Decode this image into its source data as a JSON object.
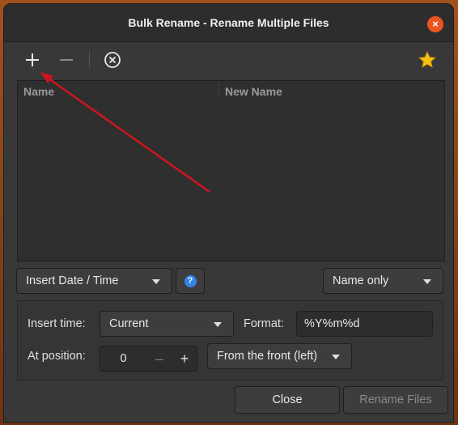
{
  "window": {
    "title": "Bulk Rename - Rename Multiple Files",
    "close_glyph": "×"
  },
  "toolbar": {
    "icons": [
      "plus-icon",
      "minus-icon",
      "clear-icon",
      "star-icon"
    ]
  },
  "file_list": {
    "columns": [
      "Name",
      "New Name"
    ],
    "rows": []
  },
  "renamer": {
    "type_selected": "Insert Date / Time",
    "help_glyph": "?",
    "scope_selected": "Name only"
  },
  "options": {
    "insert_time_label": "Insert time:",
    "insert_time_value": "Current",
    "format_label": "Format:",
    "format_value": "%Y%m%d",
    "position_label": "At position:",
    "position_value": "0",
    "position_minus": "–",
    "position_plus": "+",
    "position_from": "From the front (left)"
  },
  "actions": {
    "close_label": "Close",
    "rename_label": "Rename Files"
  },
  "colors": {
    "accent": "#e95420",
    "help_blue": "#3584e4",
    "annotation_arrow": "#d0141e"
  }
}
